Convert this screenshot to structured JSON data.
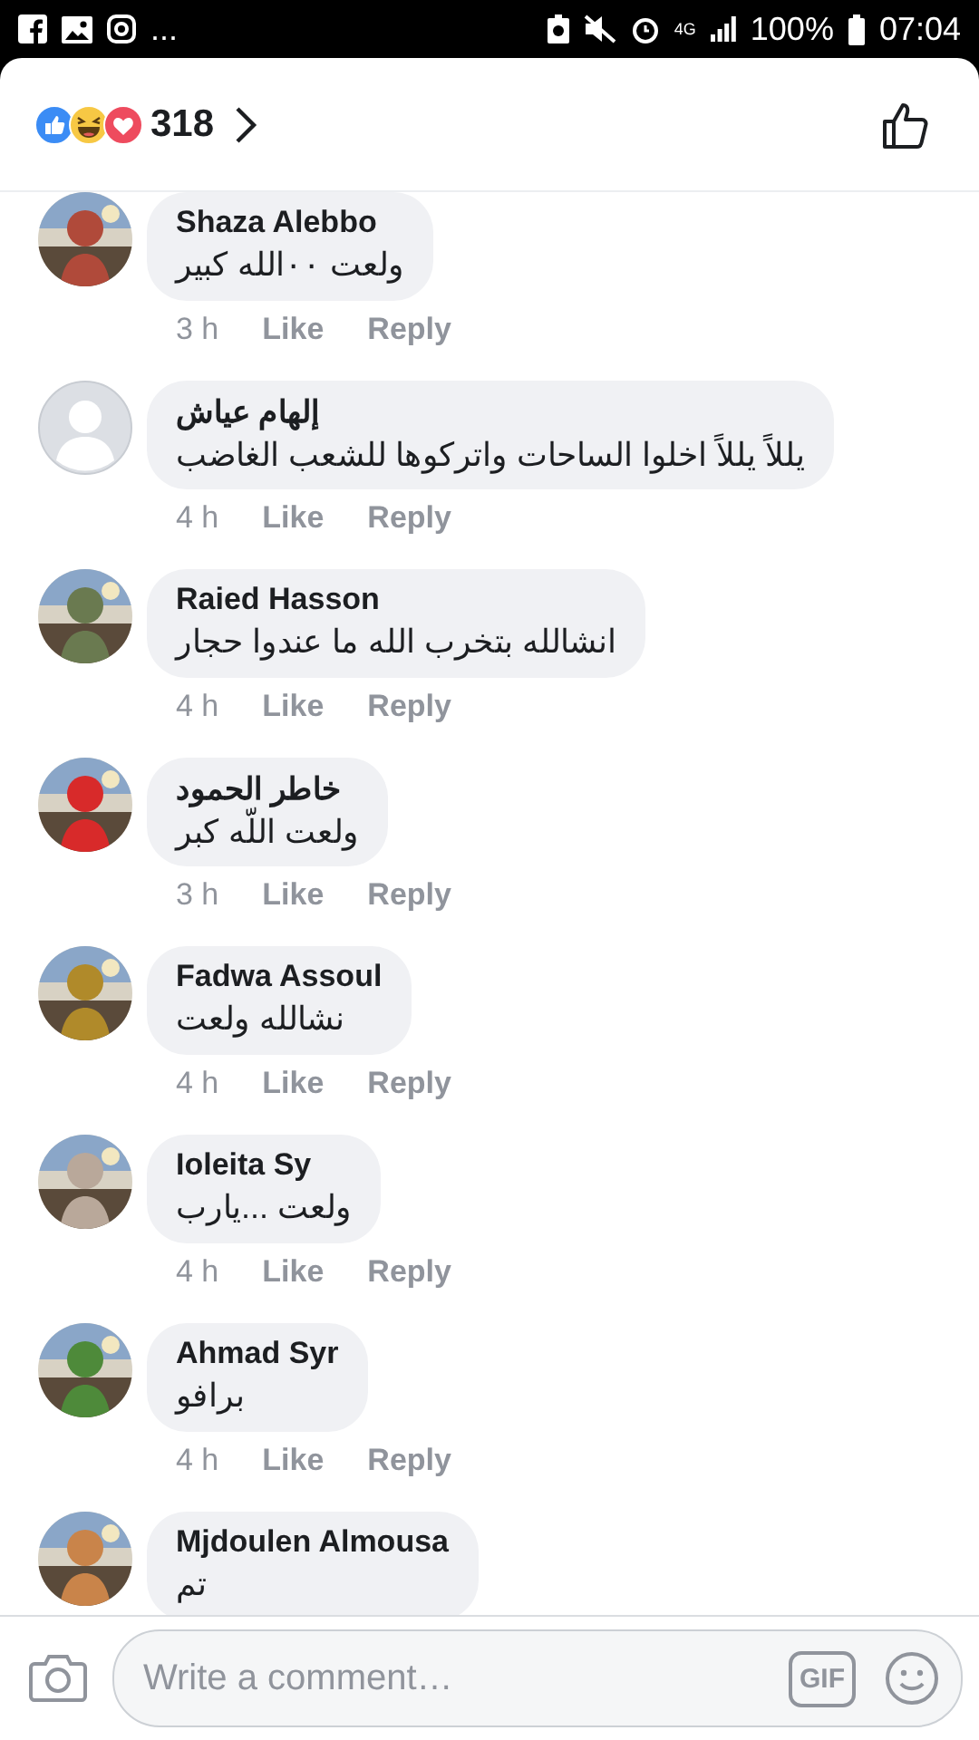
{
  "status_bar": {
    "more": "...",
    "network": "4G",
    "battery": "100%",
    "time": "07:04"
  },
  "reactions": {
    "count": "318"
  },
  "comments": [
    {
      "kind": "picture",
      "name": "Shaza Alebbo",
      "text": "ولعت ٠٠الله كبير",
      "time": "3 h",
      "like": "Like",
      "reply": "Reply"
    },
    {
      "kind": "default",
      "name": "إلهام عياش",
      "text": "يللاً يللاً اخلوا الساحات واتركوها للشعب الغاضب",
      "time": "4 h",
      "like": "Like",
      "reply": "Reply"
    },
    {
      "kind": "picture",
      "name": "Raied Hasson",
      "text": "انشالله بتخرب الله ما عندوا حجار",
      "time": "4 h",
      "like": "Like",
      "reply": "Reply"
    },
    {
      "kind": "picture",
      "name": "خاطر الحمود",
      "text": "ولعت اللّه كبر",
      "time": "3 h",
      "like": "Like",
      "reply": "Reply"
    },
    {
      "kind": "picture",
      "name": "Fadwa Assoul",
      "text": "نشالله ولعت",
      "time": "4 h",
      "like": "Like",
      "reply": "Reply"
    },
    {
      "kind": "picture",
      "name": "Ioleita Sy",
      "text": "ولعت ...يارب",
      "time": "4 h",
      "like": "Like",
      "reply": "Reply"
    },
    {
      "kind": "picture",
      "name": "Ahmad Syr",
      "text": "برافو",
      "time": "4 h",
      "like": "Like",
      "reply": "Reply"
    },
    {
      "kind": "picture",
      "name": "Mjdoulen Almousa",
      "text": "تم"
    }
  ],
  "composer": {
    "placeholder": "Write a comment…",
    "gif": "GIF"
  }
}
